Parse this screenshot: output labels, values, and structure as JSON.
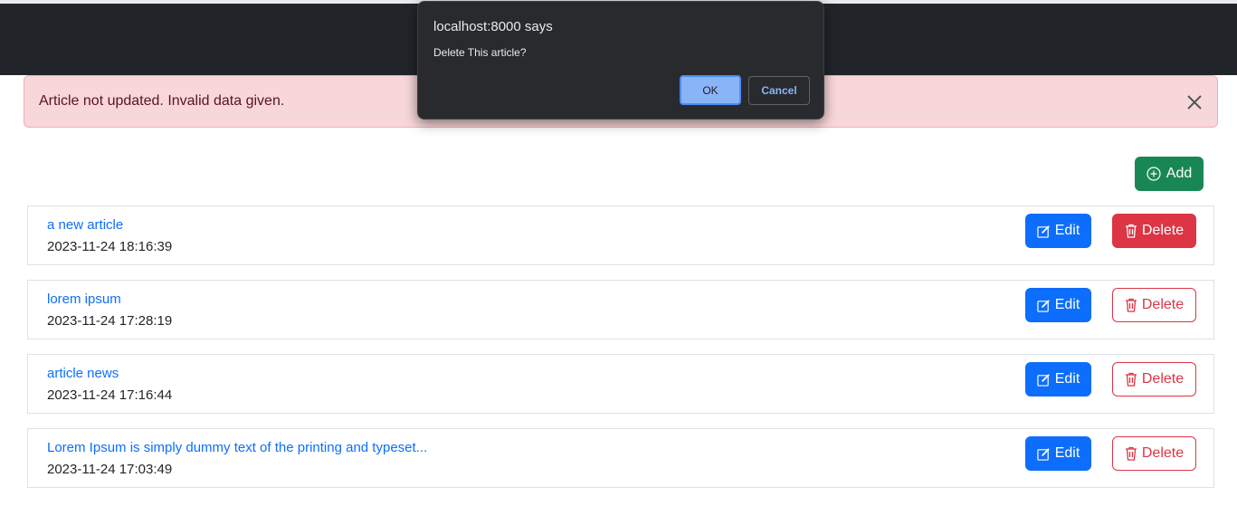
{
  "alert": {
    "message": "Article not updated. Invalid data given."
  },
  "toolbar": {
    "add_label": "Add"
  },
  "articles": [
    {
      "title": "a new article",
      "date": "2023-11-24 18:16:39",
      "edit_label": "Edit",
      "delete_label": "Delete"
    },
    {
      "title": "lorem ipsum",
      "date": "2023-11-24 17:28:19",
      "edit_label": "Edit",
      "delete_label": "Delete"
    },
    {
      "title": "article news",
      "date": "2023-11-24 17:16:44",
      "edit_label": "Edit",
      "delete_label": "Delete"
    },
    {
      "title": "Lorem Ipsum is simply dummy text of the printing and typeset...",
      "date": "2023-11-24 17:03:49",
      "edit_label": "Edit",
      "delete_label": "Delete"
    }
  ],
  "dialog": {
    "origin": "localhost:8000 says",
    "message": "Delete This article?",
    "ok_label": "OK",
    "cancel_label": "Cancel"
  },
  "colors": {
    "navbar": "#212529",
    "alert_bg": "#f8d7da",
    "primary": "#0d6efd",
    "success": "#198754",
    "danger": "#dc3545"
  },
  "icons": {
    "alert_close": "close-icon",
    "add": "plus-circle-icon",
    "edit": "pencil-square-icon",
    "delete": "trash-icon"
  }
}
